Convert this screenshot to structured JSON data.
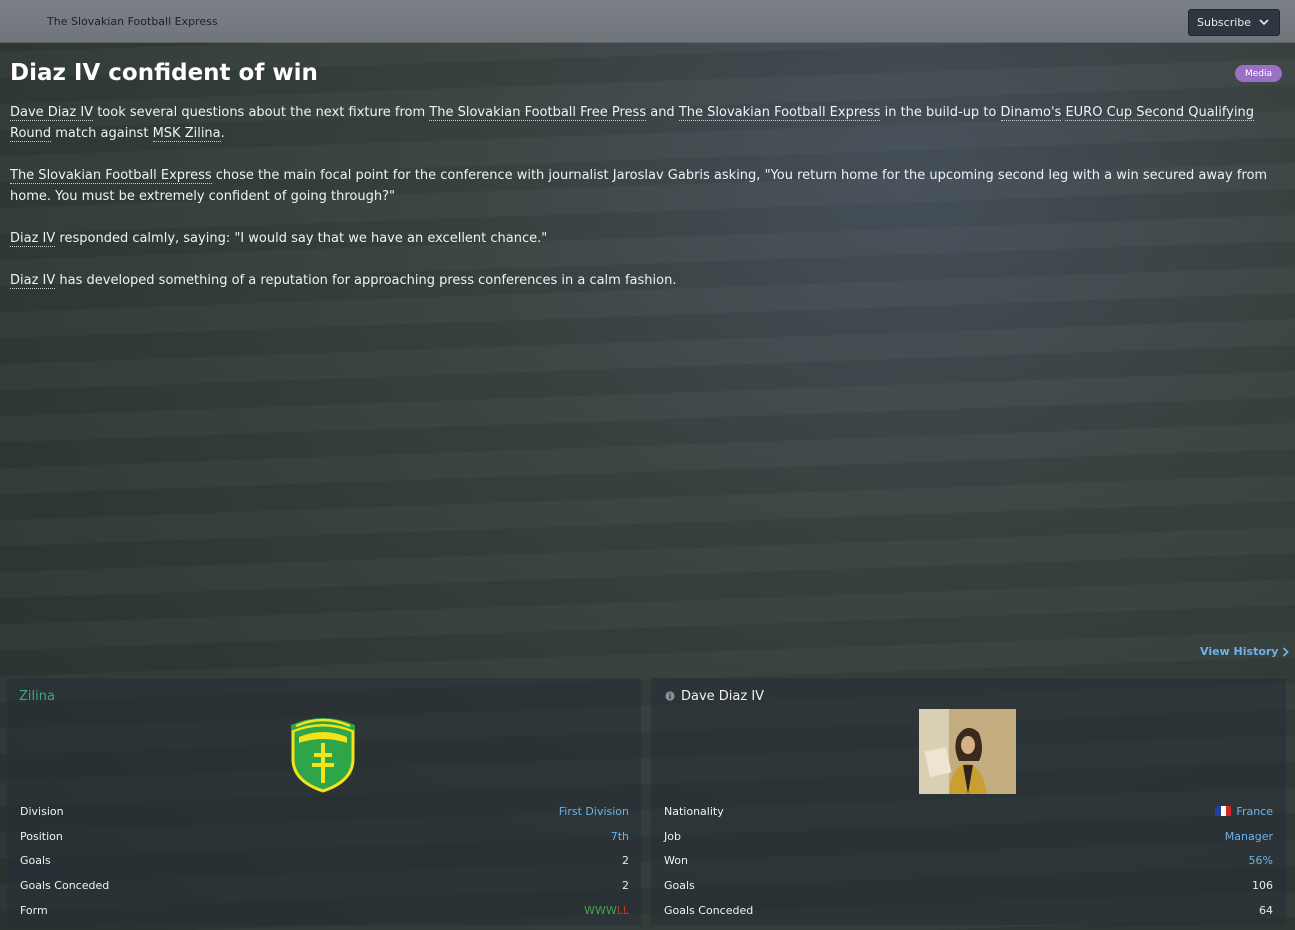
{
  "topbar": {
    "paper_name": "The Slovakian Football Express",
    "subscribe_label": "Subscribe"
  },
  "article": {
    "headline": "Diaz IV confident of win",
    "tag": "Media",
    "p1": {
      "a": "Dave Diaz IV",
      "b": " took several questions about the next fixture from ",
      "c": "The Slovakian Football Free Press",
      "d": " and ",
      "e": "The Slovakian Football Express",
      "f": " in the build-up to ",
      "g": "Dinamo's",
      "h": " ",
      "i": "EURO Cup Second Qualifying Round",
      "j": " match against ",
      "k": "MSK Zilina",
      "l": "."
    },
    "p2": {
      "a": "The Slovakian Football Express",
      "b": " chose the main focal point for the conference with journalist Jaroslav Gabris asking, \"You return home for the upcoming second leg with a win secured away from home. You must be extremely confident of going through?\""
    },
    "p3": {
      "a": "Diaz IV",
      "b": " responded calmly, saying: \"I would say that we have an excellent chance.\""
    },
    "p4": {
      "a": "Diaz IV",
      "b": " has developed something of a reputation for approaching press conferences in a calm fashion."
    }
  },
  "view_history": "View History",
  "club_panel": {
    "title": "Zilina",
    "crest_icon": "msk-zilina-crest",
    "rows": [
      {
        "label": "Division",
        "value": "First Division"
      },
      {
        "label": "Position",
        "value": "7th"
      },
      {
        "label": "Goals",
        "value": "2"
      },
      {
        "label": "Goals Conceded",
        "value": "2"
      },
      {
        "label": "Form",
        "value": ""
      }
    ],
    "form": {
      "wins": "WWW",
      "losses": "LL"
    }
  },
  "manager_panel": {
    "title": "Dave Diaz IV",
    "rows": [
      {
        "label": "Nationality",
        "value": "France"
      },
      {
        "label": "Job",
        "value": "Manager"
      },
      {
        "label": "Won",
        "value": "56%"
      },
      {
        "label": "Goals",
        "value": "106"
      },
      {
        "label": "Goals Conceded",
        "value": "64"
      }
    ]
  },
  "colors": {
    "accent_link": "#6db3e8",
    "club_green": "#3fa776",
    "media_tag": "#9b6fc6",
    "form_win": "#3fa64c",
    "form_loss": "#b83a30"
  }
}
